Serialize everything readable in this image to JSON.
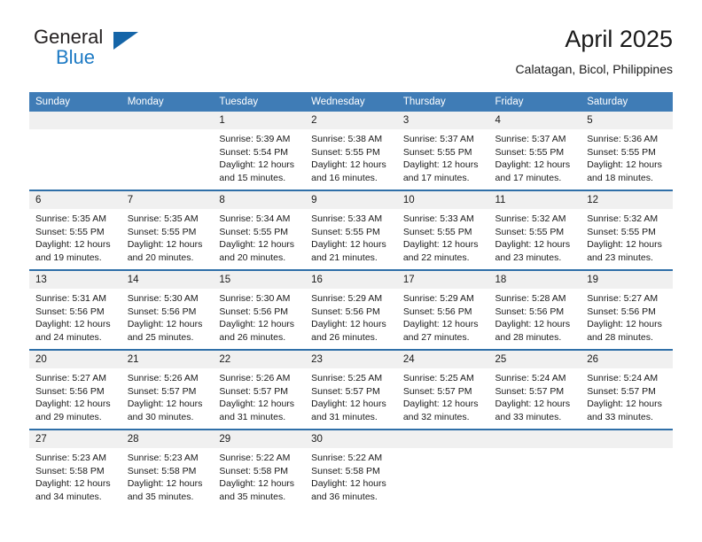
{
  "brand": {
    "name_part1": "General",
    "name_part2": "Blue",
    "triangle_color": "#1565a8",
    "blue_text_color": "#1d7ac4"
  },
  "header": {
    "title": "April 2025",
    "subtitle": "Calatagan, Bicol, Philippines"
  },
  "theme": {
    "header_blue": "#3f7cb6",
    "row_divider_blue": "#2f6fa8",
    "daynum_band": "#f0f0f0"
  },
  "weekdays": [
    "Sunday",
    "Monday",
    "Tuesday",
    "Wednesday",
    "Thursday",
    "Friday",
    "Saturday"
  ],
  "weeks": [
    [
      {
        "day": ""
      },
      {
        "day": ""
      },
      {
        "day": "1",
        "sunrise": "Sunrise: 5:39 AM",
        "sunset": "Sunset: 5:54 PM",
        "daylight_line1": "Daylight: 12 hours",
        "daylight_line2": "and 15 minutes."
      },
      {
        "day": "2",
        "sunrise": "Sunrise: 5:38 AM",
        "sunset": "Sunset: 5:55 PM",
        "daylight_line1": "Daylight: 12 hours",
        "daylight_line2": "and 16 minutes."
      },
      {
        "day": "3",
        "sunrise": "Sunrise: 5:37 AM",
        "sunset": "Sunset: 5:55 PM",
        "daylight_line1": "Daylight: 12 hours",
        "daylight_line2": "and 17 minutes."
      },
      {
        "day": "4",
        "sunrise": "Sunrise: 5:37 AM",
        "sunset": "Sunset: 5:55 PM",
        "daylight_line1": "Daylight: 12 hours",
        "daylight_line2": "and 17 minutes."
      },
      {
        "day": "5",
        "sunrise": "Sunrise: 5:36 AM",
        "sunset": "Sunset: 5:55 PM",
        "daylight_line1": "Daylight: 12 hours",
        "daylight_line2": "and 18 minutes."
      }
    ],
    [
      {
        "day": "6",
        "sunrise": "Sunrise: 5:35 AM",
        "sunset": "Sunset: 5:55 PM",
        "daylight_line1": "Daylight: 12 hours",
        "daylight_line2": "and 19 minutes."
      },
      {
        "day": "7",
        "sunrise": "Sunrise: 5:35 AM",
        "sunset": "Sunset: 5:55 PM",
        "daylight_line1": "Daylight: 12 hours",
        "daylight_line2": "and 20 minutes."
      },
      {
        "day": "8",
        "sunrise": "Sunrise: 5:34 AM",
        "sunset": "Sunset: 5:55 PM",
        "daylight_line1": "Daylight: 12 hours",
        "daylight_line2": "and 20 minutes."
      },
      {
        "day": "9",
        "sunrise": "Sunrise: 5:33 AM",
        "sunset": "Sunset: 5:55 PM",
        "daylight_line1": "Daylight: 12 hours",
        "daylight_line2": "and 21 minutes."
      },
      {
        "day": "10",
        "sunrise": "Sunrise: 5:33 AM",
        "sunset": "Sunset: 5:55 PM",
        "daylight_line1": "Daylight: 12 hours",
        "daylight_line2": "and 22 minutes."
      },
      {
        "day": "11",
        "sunrise": "Sunrise: 5:32 AM",
        "sunset": "Sunset: 5:55 PM",
        "daylight_line1": "Daylight: 12 hours",
        "daylight_line2": "and 23 minutes."
      },
      {
        "day": "12",
        "sunrise": "Sunrise: 5:32 AM",
        "sunset": "Sunset: 5:55 PM",
        "daylight_line1": "Daylight: 12 hours",
        "daylight_line2": "and 23 minutes."
      }
    ],
    [
      {
        "day": "13",
        "sunrise": "Sunrise: 5:31 AM",
        "sunset": "Sunset: 5:56 PM",
        "daylight_line1": "Daylight: 12 hours",
        "daylight_line2": "and 24 minutes."
      },
      {
        "day": "14",
        "sunrise": "Sunrise: 5:30 AM",
        "sunset": "Sunset: 5:56 PM",
        "daylight_line1": "Daylight: 12 hours",
        "daylight_line2": "and 25 minutes."
      },
      {
        "day": "15",
        "sunrise": "Sunrise: 5:30 AM",
        "sunset": "Sunset: 5:56 PM",
        "daylight_line1": "Daylight: 12 hours",
        "daylight_line2": "and 26 minutes."
      },
      {
        "day": "16",
        "sunrise": "Sunrise: 5:29 AM",
        "sunset": "Sunset: 5:56 PM",
        "daylight_line1": "Daylight: 12 hours",
        "daylight_line2": "and 26 minutes."
      },
      {
        "day": "17",
        "sunrise": "Sunrise: 5:29 AM",
        "sunset": "Sunset: 5:56 PM",
        "daylight_line1": "Daylight: 12 hours",
        "daylight_line2": "and 27 minutes."
      },
      {
        "day": "18",
        "sunrise": "Sunrise: 5:28 AM",
        "sunset": "Sunset: 5:56 PM",
        "daylight_line1": "Daylight: 12 hours",
        "daylight_line2": "and 28 minutes."
      },
      {
        "day": "19",
        "sunrise": "Sunrise: 5:27 AM",
        "sunset": "Sunset: 5:56 PM",
        "daylight_line1": "Daylight: 12 hours",
        "daylight_line2": "and 28 minutes."
      }
    ],
    [
      {
        "day": "20",
        "sunrise": "Sunrise: 5:27 AM",
        "sunset": "Sunset: 5:56 PM",
        "daylight_line1": "Daylight: 12 hours",
        "daylight_line2": "and 29 minutes."
      },
      {
        "day": "21",
        "sunrise": "Sunrise: 5:26 AM",
        "sunset": "Sunset: 5:57 PM",
        "daylight_line1": "Daylight: 12 hours",
        "daylight_line2": "and 30 minutes."
      },
      {
        "day": "22",
        "sunrise": "Sunrise: 5:26 AM",
        "sunset": "Sunset: 5:57 PM",
        "daylight_line1": "Daylight: 12 hours",
        "daylight_line2": "and 31 minutes."
      },
      {
        "day": "23",
        "sunrise": "Sunrise: 5:25 AM",
        "sunset": "Sunset: 5:57 PM",
        "daylight_line1": "Daylight: 12 hours",
        "daylight_line2": "and 31 minutes."
      },
      {
        "day": "24",
        "sunrise": "Sunrise: 5:25 AM",
        "sunset": "Sunset: 5:57 PM",
        "daylight_line1": "Daylight: 12 hours",
        "daylight_line2": "and 32 minutes."
      },
      {
        "day": "25",
        "sunrise": "Sunrise: 5:24 AM",
        "sunset": "Sunset: 5:57 PM",
        "daylight_line1": "Daylight: 12 hours",
        "daylight_line2": "and 33 minutes."
      },
      {
        "day": "26",
        "sunrise": "Sunrise: 5:24 AM",
        "sunset": "Sunset: 5:57 PM",
        "daylight_line1": "Daylight: 12 hours",
        "daylight_line2": "and 33 minutes."
      }
    ],
    [
      {
        "day": "27",
        "sunrise": "Sunrise: 5:23 AM",
        "sunset": "Sunset: 5:58 PM",
        "daylight_line1": "Daylight: 12 hours",
        "daylight_line2": "and 34 minutes."
      },
      {
        "day": "28",
        "sunrise": "Sunrise: 5:23 AM",
        "sunset": "Sunset: 5:58 PM",
        "daylight_line1": "Daylight: 12 hours",
        "daylight_line2": "and 35 minutes."
      },
      {
        "day": "29",
        "sunrise": "Sunrise: 5:22 AM",
        "sunset": "Sunset: 5:58 PM",
        "daylight_line1": "Daylight: 12 hours",
        "daylight_line2": "and 35 minutes."
      },
      {
        "day": "30",
        "sunrise": "Sunrise: 5:22 AM",
        "sunset": "Sunset: 5:58 PM",
        "daylight_line1": "Daylight: 12 hours",
        "daylight_line2": "and 36 minutes."
      },
      {
        "day": ""
      },
      {
        "day": ""
      },
      {
        "day": ""
      }
    ]
  ]
}
